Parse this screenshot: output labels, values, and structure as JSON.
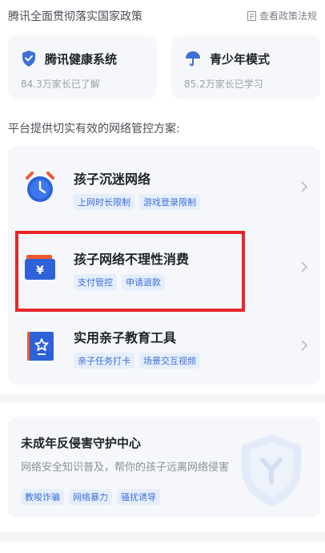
{
  "header": {
    "title": "腾讯全面贯彻落实国家政策",
    "policy_link": "查看政策法规"
  },
  "top_cards": [
    {
      "title": "腾讯健康系统",
      "subtitle": "84.3万家长已了解",
      "icon": "shield-icon"
    },
    {
      "title": "青少年模式",
      "subtitle": "85.2万家长已学习",
      "icon": "umbrella-icon"
    }
  ],
  "section": {
    "title": "平台提供切实有效的网络管控方案:"
  },
  "solutions": [
    {
      "title": "孩子沉迷网络",
      "tags": [
        "上网时长限制",
        "游戏登录限制"
      ],
      "icon": "alarm-clock-icon"
    },
    {
      "title": "孩子网络不理性消费",
      "tags": [
        "支付管控",
        "申请退款"
      ],
      "icon": "wallet-yuan-icon"
    },
    {
      "title": "实用亲子教育工具",
      "tags": [
        "亲子任务打卡",
        "场景交互视频"
      ],
      "icon": "book-star-icon"
    }
  ],
  "protect_center": {
    "title": "未成年反侵害守护中心",
    "subtitle": "网络安全知识普及，帮你的孩子远离网络侵害",
    "tags": [
      "教唆诈骗",
      "网络暴力",
      "骚扰诱导"
    ]
  },
  "colors": {
    "accent_blue": "#3d6fd6",
    "tag_bg": "#e6eefc",
    "highlight_red": "#e8262b",
    "card_bg": "#f5f7fa"
  }
}
